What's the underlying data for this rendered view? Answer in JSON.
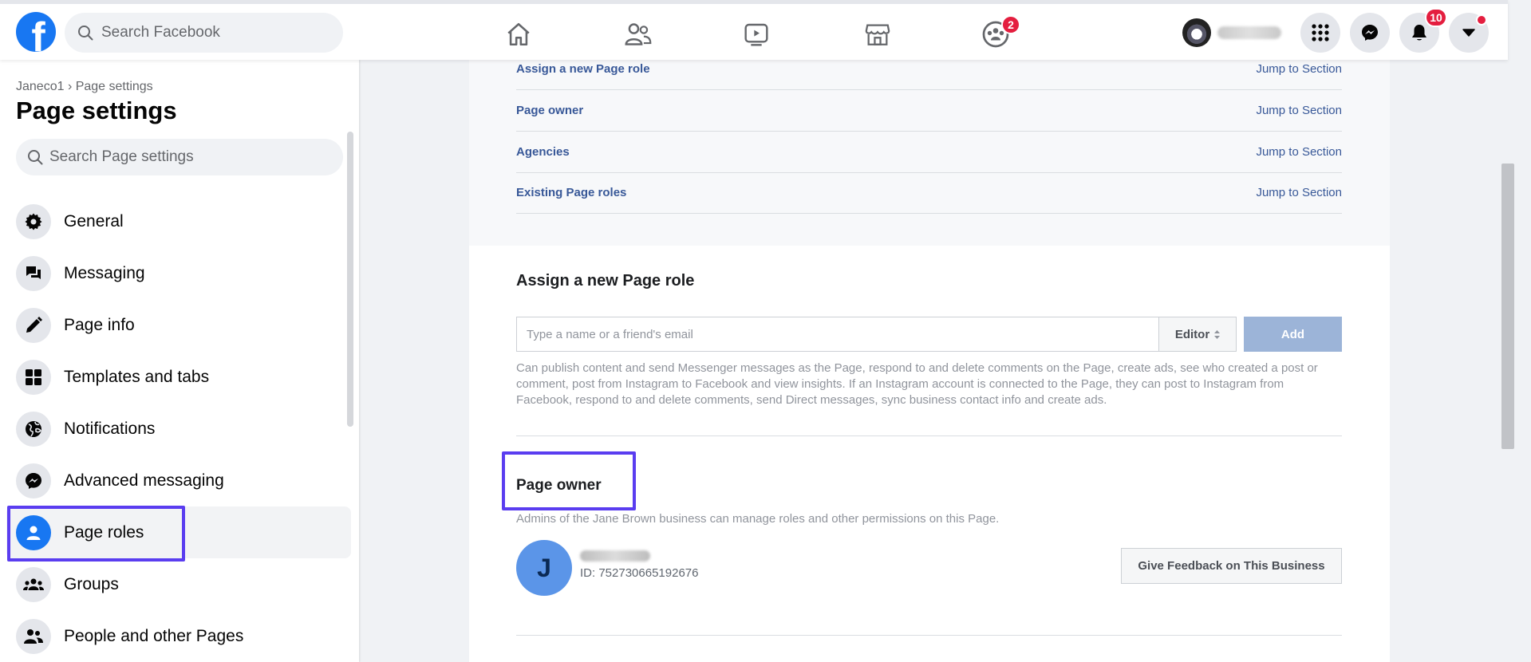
{
  "header": {
    "logo_letter": "f",
    "search_placeholder": "Search Facebook",
    "groups_badge": "2",
    "notifications_badge": "10"
  },
  "sidebar": {
    "breadcrumb": "Janeco1 › Page settings",
    "title": "Page settings",
    "search_placeholder": "Search Page settings",
    "items": [
      {
        "label": "General",
        "icon": "gear-icon"
      },
      {
        "label": "Messaging",
        "icon": "chat-icon"
      },
      {
        "label": "Page info",
        "icon": "pencil-icon"
      },
      {
        "label": "Templates and tabs",
        "icon": "grid-icon"
      },
      {
        "label": "Notifications",
        "icon": "globe-icon"
      },
      {
        "label": "Advanced messaging",
        "icon": "messenger-icon"
      },
      {
        "label": "Page roles",
        "icon": "person-icon",
        "active": true
      },
      {
        "label": "Groups",
        "icon": "groups-icon"
      },
      {
        "label": "People and other Pages",
        "icon": "people-icon"
      }
    ]
  },
  "jump_rows": [
    {
      "name": "Assign a new Page role",
      "link": "Jump to Section"
    },
    {
      "name": "Page owner",
      "link": "Jump to Section"
    },
    {
      "name": "Agencies",
      "link": "Jump to Section"
    },
    {
      "name": "Existing Page roles",
      "link": "Jump to Section"
    }
  ],
  "assign_role": {
    "title": "Assign a new Page role",
    "input_placeholder": "Type a name or a friend's email",
    "role_select": "Editor",
    "add_label": "Add",
    "description": "Can publish content and send Messenger messages as the Page, respond to and delete comments on the Page, create ads, see who created a post or comment, post from Instagram to Facebook and view insights. If an Instagram account is connected to the Page, they can post to Instagram from Facebook, respond to and delete comments, send Direct messages, sync business contact info and create ads."
  },
  "page_owner": {
    "title": "Page owner",
    "description": "Admins of the Jane Brown business can manage roles and other permissions on this Page.",
    "avatar_letter": "J",
    "owner_id": "ID: 752730665192676",
    "feedback_label": "Give Feedback on This Business"
  },
  "colors": {
    "brand": "#1877f2",
    "link": "#385898",
    "highlight": "#5a3df0",
    "badge": "#e41e3f"
  }
}
